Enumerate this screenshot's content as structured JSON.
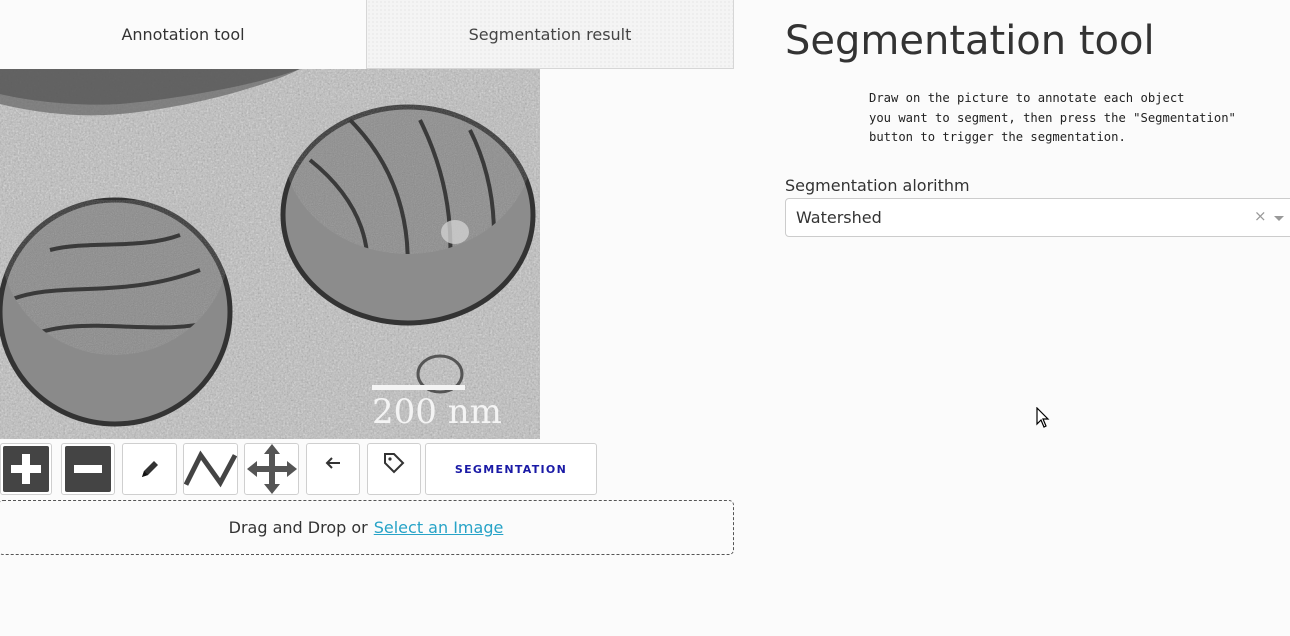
{
  "tabs": [
    {
      "label": "Annotation tool",
      "active": true
    },
    {
      "label": "Segmentation result",
      "active": false
    }
  ],
  "image": {
    "scale_bar_label": "200 nm"
  },
  "toolbar": {
    "tools": [
      {
        "name": "zoom-in",
        "icon": "plus-icon"
      },
      {
        "name": "zoom-out",
        "icon": "minus-icon"
      },
      {
        "name": "draw",
        "icon": "pencil-icon"
      },
      {
        "name": "draw-path",
        "icon": "zigzag-icon"
      },
      {
        "name": "pan",
        "icon": "move-icon"
      },
      {
        "name": "undo",
        "icon": "arrow-left-icon"
      },
      {
        "name": "label",
        "icon": "tag-icon"
      }
    ],
    "segmentation_label": "SEGMENTATION"
  },
  "upload": {
    "text": "Drag and Drop or",
    "link": "Select an Image"
  },
  "panel": {
    "title": "Segmentation tool",
    "instructions": "Draw on the picture to annotate each object\nyou want to segment, then press the \"Segmentation\"\nbutton to trigger the segmentation.",
    "algorithm_label": "Segmentation alorithm",
    "algorithm_value": "Watershed",
    "clear_glyph": "×"
  },
  "colors": {
    "background": "#fbfbfb",
    "segmentation_text": "#1a1aa6",
    "link": "#27a3c7",
    "tool_dark": "#444444"
  }
}
